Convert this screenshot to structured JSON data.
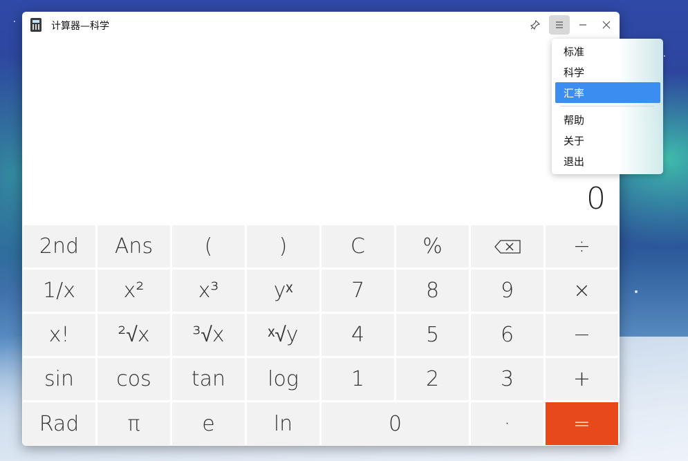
{
  "window": {
    "title": "计算器—科学"
  },
  "titlebar": {
    "pin_icon": "pin-icon",
    "menu_icon": "hamburger-icon",
    "minimize_icon": "minimize-icon",
    "close_icon": "close-icon"
  },
  "display": {
    "value": "0"
  },
  "keys": {
    "r1": [
      "2nd",
      "Ans",
      "(",
      ")",
      "C",
      "%",
      "",
      "÷"
    ],
    "r2": [
      "1/x",
      "x²",
      "x³",
      "yˣ",
      "7",
      "8",
      "9",
      "×"
    ],
    "r3": [
      "x!",
      "²√x",
      "³√x",
      "ˣ√y",
      "4",
      "5",
      "6",
      "−"
    ],
    "r4": [
      "sin",
      "cos",
      "tan",
      "log",
      "1",
      "2",
      "3",
      "+"
    ],
    "r5": [
      "Rad",
      "π",
      "e",
      "ln",
      "0",
      "·",
      "="
    ]
  },
  "menu": {
    "items": [
      "标准",
      "科学",
      "汇率",
      "帮助",
      "关于",
      "退出"
    ],
    "selected": "汇率"
  },
  "colors": {
    "accent": "#e8491b",
    "selection": "#3b8ef0"
  }
}
